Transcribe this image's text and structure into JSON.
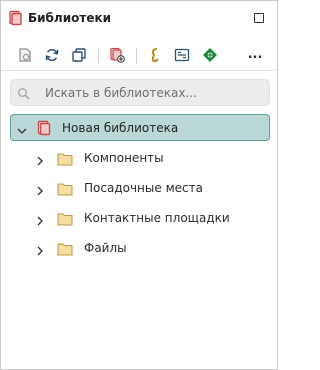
{
  "header": {
    "title": "Библиотеки"
  },
  "toolbar": {
    "buttons": [
      {
        "icon": "open-library-icon"
      },
      {
        "icon": "refresh-icon"
      },
      {
        "icon": "copy-window-icon"
      },
      {
        "icon": "add-library-icon"
      },
      {
        "icon": "symbol-icon"
      },
      {
        "icon": "footprint-icon"
      },
      {
        "icon": "pad-icon"
      }
    ],
    "more_label": "..."
  },
  "search": {
    "placeholder": "Искать в библиотеках..."
  },
  "tree": {
    "root": {
      "label": "Новая библиотека",
      "expanded": true
    },
    "items": [
      {
        "label": "Компоненты"
      },
      {
        "label": "Посадочные места"
      },
      {
        "label": "Контактные площадки"
      },
      {
        "label": "Файлы"
      }
    ]
  },
  "colors": {
    "selection_fill": "#b9d8d6",
    "selection_border": "#5f9c99",
    "folder_fill": "#f5dea0",
    "library_red": "#c94a4a",
    "accent_green": "#1a8a3a",
    "accent_gold": "#b58a1a"
  }
}
